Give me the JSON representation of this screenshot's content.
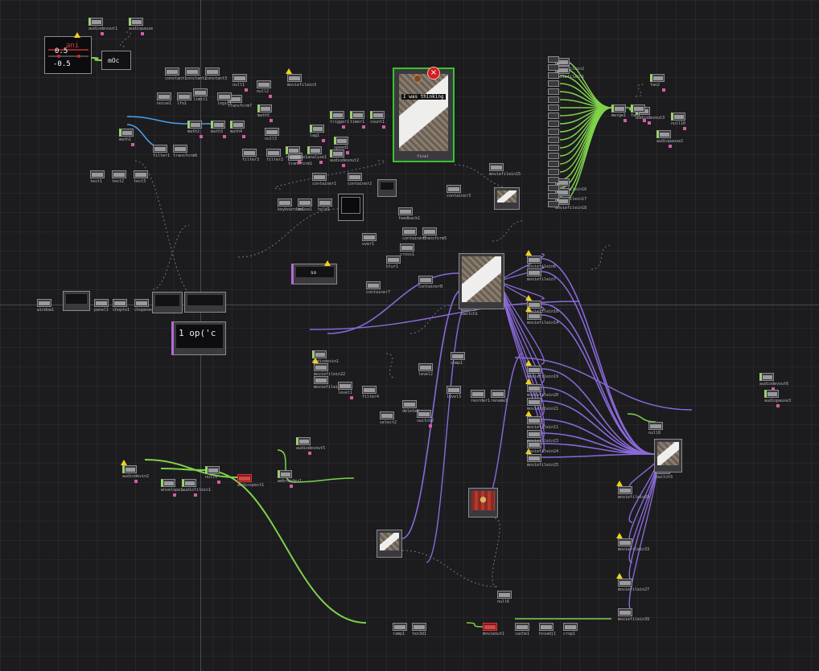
{
  "colors": {
    "background": "#1c1c1f",
    "wire_chop": "#7fd24a",
    "wire_top": "#8a6ad8",
    "wire_mat": "#4aa0f0",
    "dependency": "#6a7580",
    "selected": "#39c32a",
    "error": "#c81a1a",
    "warning": "#f0d21a"
  },
  "icons": {
    "warning": "warning-triangle-icon",
    "error": "error-x-icon"
  },
  "chop_display": {
    "label": "ani",
    "top_value": "0.5",
    "bottom_value": "-0.5"
  },
  "math_node": {
    "label": "mOc"
  },
  "code_preview": {
    "text": "1  op('c"
  },
  "text_preview": {
    "caption": "I was thinking",
    "center_text": "so"
  },
  "nodes": {
    "audiodevin2": "audiodevin2",
    "audiodevout1": "audiodevout1",
    "audiodevout2": "audiodevout2",
    "audiodevout3": "audiodevout3",
    "audiodevout5": "audiodevout5",
    "audiodevout6": "audiodevout6",
    "audiodevin1": "audiodevin1",
    "audiopause": "audiopause",
    "audiopause2": "audiopause2",
    "audiopause3": "audiopause3",
    "moviefilein3": "moviefilein3",
    "moviefilein15": "moviefilein15",
    "moviefilein6": "moviefilein6",
    "moviefilein7": "moviefilein7",
    "moviefilein10": "moviefilein10",
    "moviefilein14": "moviefilein14",
    "moviefilein20": "moviefilein20",
    "moviefilein11": "moviefilein11",
    "moviefilein25": "moviefilein25",
    "moviefilein22": "moviefilein22",
    "moviefilein12": "moviefilein12",
    "moviefilein33": "moviefilein33",
    "moviefilein39": "moviefilein39",
    "moviefilein24": "moviefilein24",
    "moviefilein19": "moviefilein19",
    "moviefilein21": "moviefilein21",
    "moviefilein16": "moviefilein16",
    "moviefilein17": "moviefilein17",
    "moviefilein18": "moviefilein18",
    "moviefilein23": "moviefilein23",
    "moviefilein29": "moviefilein29",
    "moviefilein27": "moviefilein27",
    "moviefilein2": "moviefilein2",
    "moviefilein1": "moviefilein1",
    "container1": "container1",
    "container2": "container2",
    "container3": "container3",
    "container5": "container5",
    "container7": "container7",
    "containerB": "containerB",
    "transform1": "transform1",
    "transform5": "transform5",
    "transform6": "transform6",
    "transform7": "transform7",
    "switch1": "switch1",
    "switch2": "switch2",
    "switch3": "switch3",
    "select2": "select2",
    "null1": "null1",
    "null2": "null2",
    "null3": "null3",
    "null5": "null5",
    "null6": "null6",
    "null8": "null8",
    "null10": "null10",
    "math1": "math1",
    "math2": "math2",
    "math3": "math3",
    "math4": "math4",
    "math5": "math5",
    "filter1": "filter1",
    "filter2": "filter2",
    "filter3": "filter3",
    "filter4": "filter4",
    "level1": "level1",
    "level2": "level2",
    "level3": "level3",
    "text1": "text1",
    "text2": "text2",
    "text3": "text3",
    "final": "final",
    "window1": "window1",
    "chopto1": "chopto1",
    "chopexec1": "chopexec1",
    "panel1": "panel1",
    "resample1": "resample1",
    "analyze1": "analyze1",
    "trigger1": "trigger1",
    "timer1": "timer1",
    "count1": "count1",
    "lag1": "lag1",
    "speed1": "speed1",
    "merge1": "merge1",
    "fan1": "fan1",
    "fan2": "fan2",
    "constant1": "constant1",
    "constant2": "constant2",
    "constant3": "constant3",
    "noise1": "noise1",
    "lfo1": "lfo1",
    "limit1": "limit1",
    "logic1": "logic1",
    "keyboardin1": "keyboardin1",
    "mouse1": "mouse1",
    "hold1": "hold1",
    "feedback1": "feedback1",
    "over1": "over1",
    "cross1": "cross1",
    "blur1": "blur1",
    "comp1": "comp1",
    "reorder1": "reorder1",
    "rename1": "rename1",
    "delete1": "delete1",
    "envelope1": "envelope1",
    "audiofilein1": "audiofilein1",
    "audiospect1": "audiospect1",
    "webrender1": "webrender1",
    "movieout1": "movieout1",
    "cache1": "cache1",
    "hsvadj1": "hsvadj1",
    "crop1": "crop1",
    "ramp1": "ramp1",
    "tex3d1": "tex3d1"
  }
}
